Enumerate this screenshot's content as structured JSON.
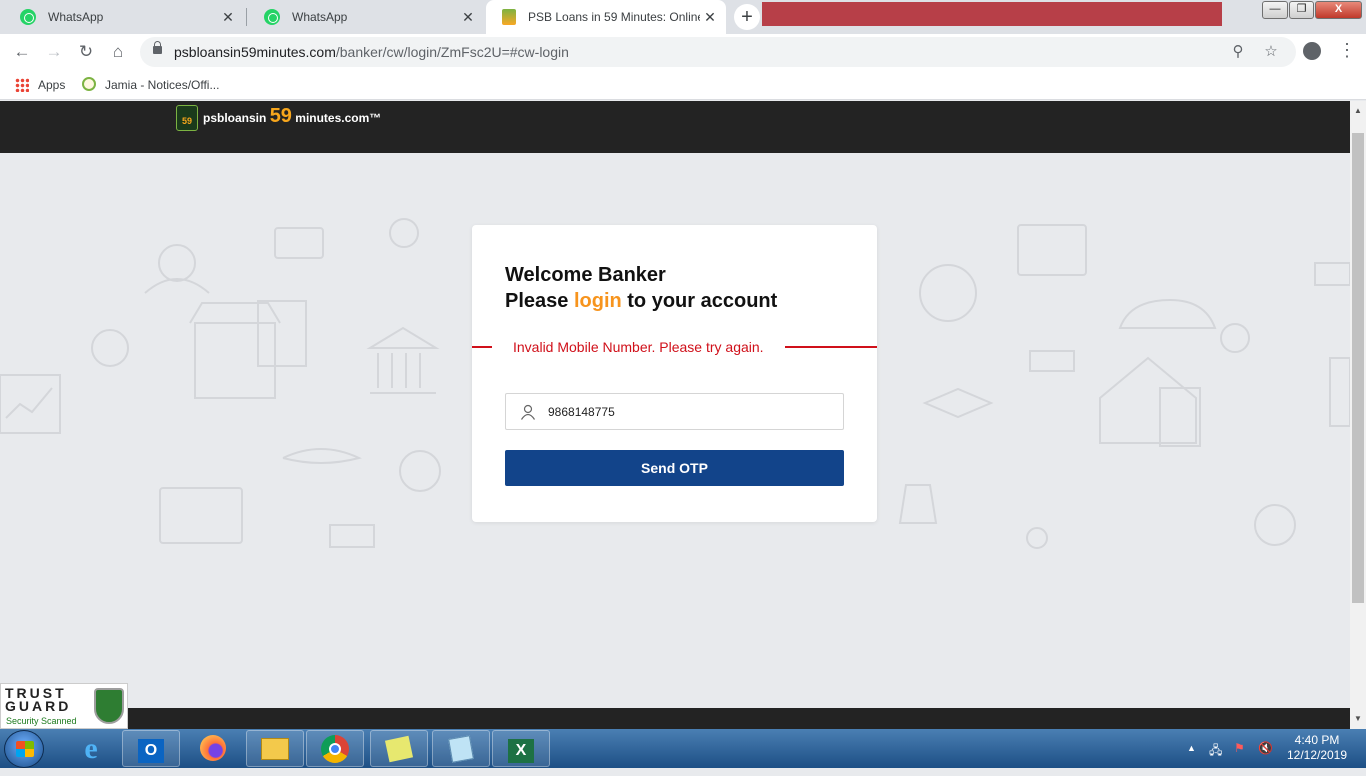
{
  "browser": {
    "tabs": [
      {
        "title": "WhatsApp",
        "icon": "whatsapp-icon"
      },
      {
        "title": "WhatsApp",
        "icon": "whatsapp-icon"
      },
      {
        "title": "PSB Loans in 59 Minutes: Online",
        "icon": "psb-favicon"
      }
    ],
    "new_tab": "+",
    "window_controls": {
      "minimize": "—",
      "maximize": "❐",
      "close": "X"
    },
    "url_host": "psbloansin59minutes.com",
    "url_path": "/banker/cw/login/ZmFsc2U=#cw-login",
    "bookmarks": [
      {
        "label": "Apps",
        "icon": "apps-grid-icon"
      },
      {
        "label": "Jamia - Notices/Offi...",
        "icon": "jamia-icon"
      }
    ]
  },
  "site": {
    "logo_badge": "59",
    "logo_prefix": "psbloansin ",
    "logo_number": "59",
    "logo_suffix": " minutes.com™"
  },
  "login_card": {
    "line1": "Welcome Banker",
    "line2_before": "Please ",
    "line2_highlight": "login",
    "line2_after": " to your account",
    "error_message": "Invalid Mobile Number. Please try again.",
    "mobile_value": "9868148775",
    "send_button": "Send OTP"
  },
  "trustguard": {
    "line1": "TRUST",
    "line2": "GUARD",
    "sub": "Security Scanned"
  },
  "taskbar": {
    "time": "4:40 PM",
    "date": "12/12/2019",
    "items": [
      "internet-explorer-icon",
      "outlook-icon",
      "firefox-icon",
      "file-explorer-icon",
      "chrome-icon",
      "sticky-notes-icon",
      "notepad-icon",
      "excel-icon"
    ]
  },
  "colors": {
    "accent_orange": "#f7941d",
    "error_red": "#d0101a",
    "button_blue": "#12448a",
    "header_dark": "#232323"
  }
}
